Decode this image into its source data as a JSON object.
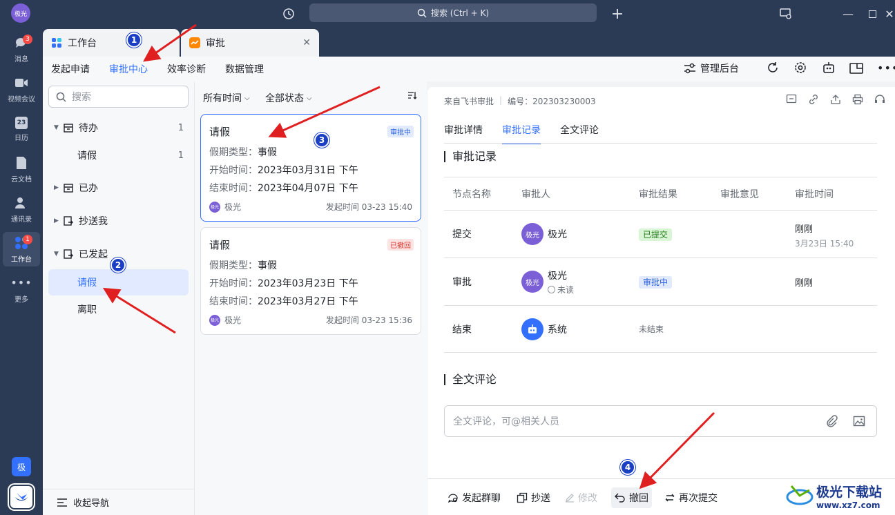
{
  "app": {
    "user_avatar_text": "极光",
    "search_placeholder": "搜索 (Ctrl + K)"
  },
  "nav": [
    {
      "label": "消息",
      "badge": "3",
      "icon": "chat-icon"
    },
    {
      "label": "视频会议",
      "icon": "video-icon"
    },
    {
      "label": "日历",
      "icon": "calendar-icon",
      "icon_text": "23"
    },
    {
      "label": "云文档",
      "icon": "doc-icon"
    },
    {
      "label": "通讯录",
      "icon": "contacts-icon"
    },
    {
      "label": "工作台",
      "badge": "1",
      "icon": "workplace-icon",
      "active": true
    },
    {
      "label": "更多",
      "icon": "more-icon"
    }
  ],
  "nav_bottom_avatar": "极",
  "tabs": {
    "tab1": "工作台",
    "tab2": "审批"
  },
  "subtabs": [
    "发起申请",
    "审批中心",
    "效率诊断",
    "数据管理"
  ],
  "toolbar": {
    "admin": "管理后台"
  },
  "sidebar": {
    "search_placeholder": "搜索",
    "groups": [
      {
        "label": "待办",
        "count": "1"
      },
      {
        "label": "请假",
        "count": "1"
      },
      {
        "label": "已办"
      },
      {
        "label": "抄送我"
      },
      {
        "label": "已发起"
      },
      {
        "label": "请假"
      },
      {
        "label": "离职"
      }
    ],
    "collapse": "收起导航"
  },
  "filters": {
    "time": "所有时间",
    "status": "全部状态"
  },
  "cards": [
    {
      "title": "请假",
      "tag": "审批中",
      "type_k": "假期类型：",
      "type_v": "事假",
      "start_k": "开始时间：",
      "start_v": "2023年03月31日 下午",
      "end_k": "结束时间：",
      "end_v": "2023年04月07日 下午",
      "avatar": "极光",
      "user": "极光",
      "time": "发起时间 03-23 15:40"
    },
    {
      "title": "请假",
      "tag": "已撤回",
      "type_k": "假期类型：",
      "type_v": "事假",
      "start_k": "开始时间：",
      "start_v": "2023年03月23日 下午",
      "end_k": "结束时间：",
      "end_v": "2023年03月27日 下午",
      "avatar": "极光",
      "user": "极光",
      "time": "发起时间 03-23 15:36"
    }
  ],
  "detail": {
    "source": "来自飞书审批",
    "number": "编号：202303230003",
    "tabs": [
      "审批详情",
      "审批记录",
      "全文评论"
    ],
    "record_title": "审批记录",
    "columns": [
      "节点名称",
      "审批人",
      "审批结果",
      "审批意见",
      "审批时间"
    ],
    "rows": [
      {
        "node": "提交",
        "avatar": "极光",
        "person": "极光",
        "result": "已提交",
        "time": "刚刚",
        "time2": "3月23日 15:40"
      },
      {
        "node": "审批",
        "avatar": "极光",
        "person": "极光",
        "sub": "未读",
        "result": "审批中",
        "time": "刚刚"
      },
      {
        "node": "结束",
        "person": "系统",
        "result": "未结束"
      }
    ],
    "comment_title": "全文评论",
    "comment_placeholder": "全文评论，可@相关人员"
  },
  "actions": [
    "发起群聊",
    "抄送",
    "修改",
    "撤回",
    "再次提交"
  ],
  "markers": [
    "1",
    "2",
    "3",
    "4"
  ],
  "watermark": {
    "name": "极光下载站",
    "url": "www.xz7.com"
  },
  "colors": {
    "accent": "#3370ff",
    "sidebar_dark": "#2b3a55",
    "arrow": "#e02020"
  }
}
